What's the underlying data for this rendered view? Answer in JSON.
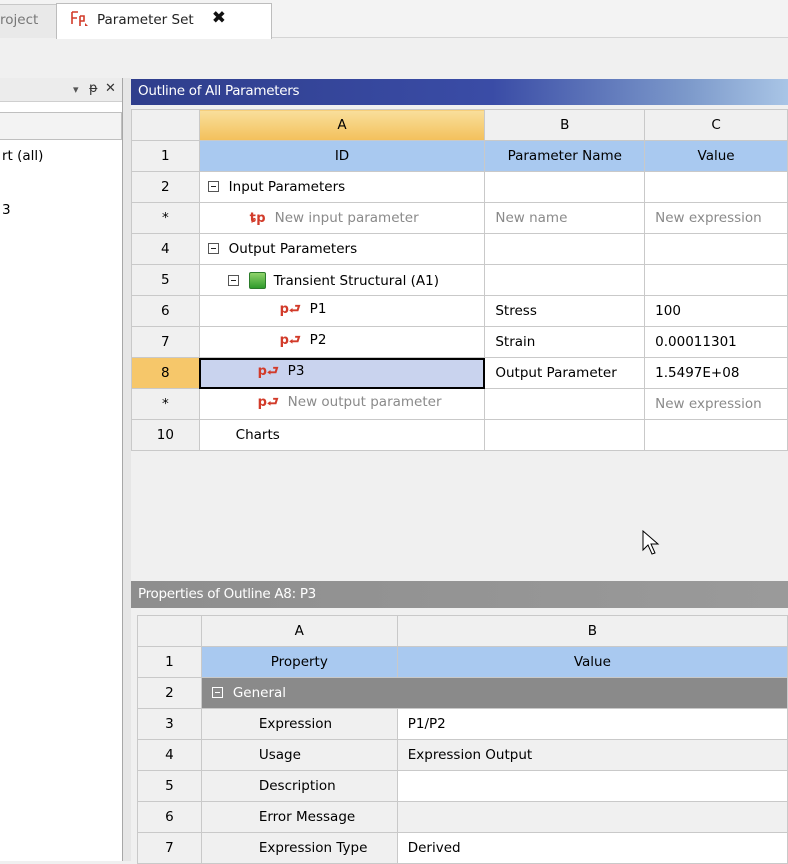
{
  "tabs": {
    "prev_label": "roject",
    "active_label": "Parameter Set",
    "close_glyph": "✖"
  },
  "left_panel": {
    "controls": [
      "▾",
      "ᵽ",
      "✕"
    ],
    "item1": "rt (all)",
    "item2": "3"
  },
  "outline": {
    "title": "Outline of All Parameters",
    "columns": [
      "A",
      "B",
      "C"
    ],
    "header": {
      "row": "1",
      "id": "ID",
      "name": "Parameter Name",
      "value": "Value"
    },
    "rows": [
      {
        "num": "2",
        "id": "Input Parameters",
        "name": "",
        "value": ""
      },
      {
        "num": "*",
        "id": "New input parameter",
        "name": "New name",
        "value": "New expression"
      },
      {
        "num": "4",
        "id": "Output Parameters",
        "name": "",
        "value": ""
      },
      {
        "num": "5",
        "id": "Transient Structural (A1)",
        "name": "",
        "value": ""
      },
      {
        "num": "6",
        "id": "P1",
        "name": "Stress",
        "value": "100"
      },
      {
        "num": "7",
        "id": "P2",
        "name": "Strain",
        "value": "0.00011301"
      },
      {
        "num": "8",
        "id": "P3",
        "name": "Output Parameter",
        "value": "1.5497E+08"
      },
      {
        "num": "*",
        "id": "New output parameter",
        "name": "",
        "value": "New expression"
      },
      {
        "num": "10",
        "id": "Charts",
        "name": "",
        "value": ""
      }
    ]
  },
  "properties": {
    "title": "Properties of Outline A8: P3",
    "columns": [
      "A",
      "B"
    ],
    "header": {
      "row": "1",
      "property": "Property",
      "value": "Value"
    },
    "rows": [
      {
        "num": "2",
        "property": "General",
        "value": ""
      },
      {
        "num": "3",
        "property": "Expression",
        "value": "P1/P2"
      },
      {
        "num": "4",
        "property": "Usage",
        "value": "Expression Output"
      },
      {
        "num": "5",
        "property": "Description",
        "value": ""
      },
      {
        "num": "6",
        "property": "Error Message",
        "value": ""
      },
      {
        "num": "7",
        "property": "Expression Type",
        "value": "Derived"
      }
    ]
  },
  "colors": {
    "outline_title_bg": "#2f3e8c",
    "header_blue": "#a9c9f0",
    "selected_col": "#f3c05b",
    "param_icon": "#d23b2a"
  }
}
